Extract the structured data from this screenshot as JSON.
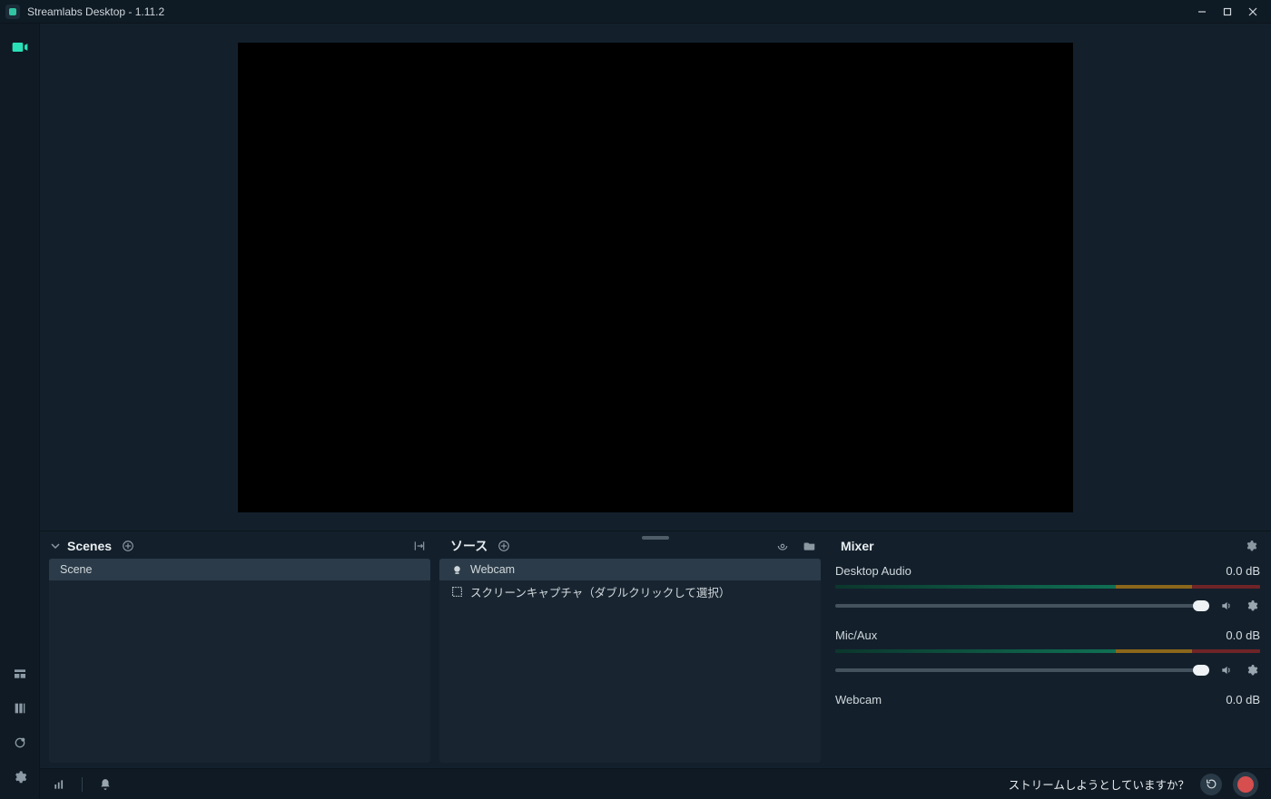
{
  "title": "Streamlabs Desktop - 1.11.2",
  "leftRail": {
    "active": "camera"
  },
  "panels": {
    "scenes": {
      "title": "Scenes",
      "items": [
        {
          "label": "Scene",
          "selected": true
        }
      ]
    },
    "sources": {
      "title": "ソース",
      "items": [
        {
          "label": "Webcam",
          "icon": "webcam",
          "selected": true
        },
        {
          "label": "スクリーンキャプチャ（ダブルクリックして選択）",
          "icon": "screen",
          "selected": false
        }
      ]
    },
    "mixer": {
      "title": "Mixer",
      "channels": [
        {
          "name": "Desktop Audio",
          "db": "0.0 dB"
        },
        {
          "name": "Mic/Aux",
          "db": "0.0 dB"
        },
        {
          "name": "Webcam",
          "db": "0.0 dB"
        }
      ]
    }
  },
  "bottom": {
    "streamingQuestion": "ストリームしようとしていますか？"
  }
}
